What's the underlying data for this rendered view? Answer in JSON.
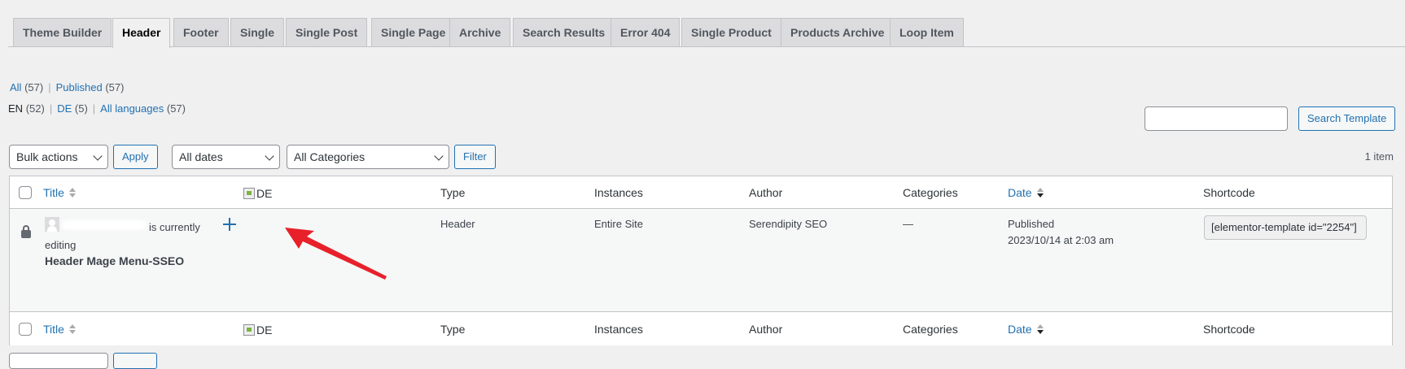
{
  "tabs": [
    {
      "label": "Theme Builder"
    },
    {
      "label": "Header",
      "active": true
    },
    {
      "label": "Footer"
    },
    {
      "label": "Single"
    },
    {
      "label": "Single Post"
    },
    {
      "label": "Single Page"
    },
    {
      "label": "Archive"
    },
    {
      "label": "Search Results"
    },
    {
      "label": "Error 404"
    },
    {
      "label": "Single Product"
    },
    {
      "label": "Products Archive"
    },
    {
      "label": "Loop Item"
    }
  ],
  "status_filters": {
    "all_label": "All",
    "all_count": "(57)",
    "published_label": "Published",
    "published_count": "(57)"
  },
  "language_filters": {
    "en_label": "EN",
    "en_count": "(52)",
    "de_label": "DE",
    "de_count": "(5)",
    "all_label": "All languages",
    "all_count": "(57)"
  },
  "search": {
    "placeholder": "",
    "button_label": "Search Template"
  },
  "toolbar": {
    "bulk_actions": "Bulk actions",
    "apply_label": "Apply",
    "dates": "All dates",
    "categories": "All Categories",
    "filter_label": "Filter",
    "items_count": "1 item"
  },
  "columns": {
    "title": "Title",
    "language": "DE",
    "type": "Type",
    "instances": "Instances",
    "author": "Author",
    "categories": "Categories",
    "date": "Date",
    "shortcode": "Shortcode"
  },
  "row": {
    "editing_suffix": "is currently",
    "editing_word": "editing",
    "title": "Header Mage Menu-SSEO",
    "type": "Header",
    "instances": "Entire Site",
    "author": "Serendipity SEO",
    "categories": "—",
    "status": "Published",
    "date": "2023/10/14 at 2:03 am",
    "shortcode": "[elementor-template id=\"2254\"]"
  },
  "colors": {
    "link": "#2271b1",
    "annotation_arrow": "#e8202a"
  }
}
